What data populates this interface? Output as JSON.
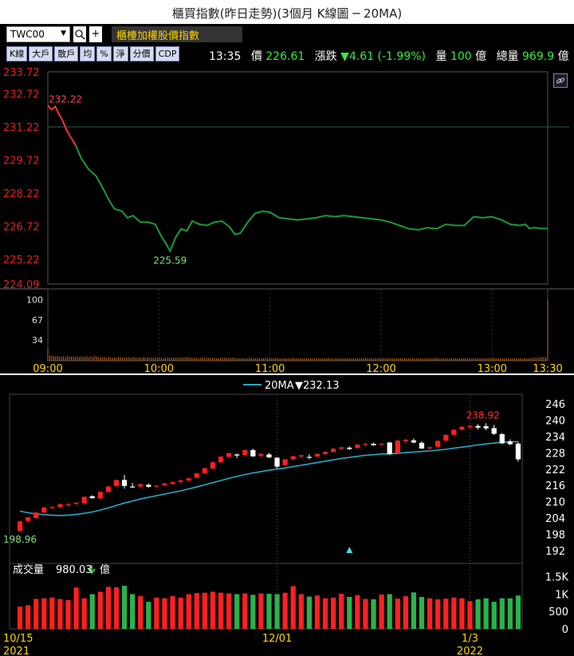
{
  "title": "櫃買指數(昨日走勢)(3個月 K線圖 ─ 20MA)",
  "toolbar": {
    "symbol": "TWC00",
    "dropdown_glyph": "▼",
    "search_glyph": "🔍",
    "add_glyph": "+",
    "name": "櫃檯加權股價指數",
    "tabs": [
      "K線",
      "大戶",
      "散戶",
      "均",
      "%",
      "淨",
      "分價",
      "CDP"
    ]
  },
  "quote": {
    "time": "13:35",
    "price_label": "價",
    "price": "226.61",
    "change_label": "漲跌",
    "change": "▼4.61 (-1.99%)",
    "volume_label": "量",
    "volume": "100",
    "volume_unit": "億",
    "total_label": "總量",
    "total": "969.9",
    "total_unit": "億"
  },
  "icons": {
    "link": "link-icon",
    "search": "search-icon",
    "volume_arrow": "down-arrow-icon",
    "marker": "triangle-up-icon"
  },
  "colors": {
    "up": "#ff2020",
    "down": "#2bb24c",
    "ma": "#2aa8c8",
    "intraday": "#1a9a3a",
    "vol": "#cc6a1a",
    "open_line": "#2f5f4f"
  },
  "intraday": {
    "price_ticks": [
      "233.72",
      "232.72",
      "231.22",
      "229.72",
      "228.22",
      "226.72",
      "225.22",
      "224.09"
    ],
    "price_tick_values": [
      233.72,
      232.72,
      231.22,
      229.72,
      228.22,
      226.72,
      225.22,
      224.09
    ],
    "time_ticks": [
      "09:00",
      "10:00",
      "11:00",
      "12:00",
      "13:00",
      "13:30"
    ],
    "time_tick_minutes": [
      0,
      60,
      120,
      180,
      240,
      270
    ],
    "volume_ticks": [
      "100",
      "67",
      "34"
    ],
    "volume_tick_values": [
      100,
      67,
      34
    ],
    "prev_close": 231.22,
    "high_label": "232.22",
    "low_label": "225.59",
    "high": 232.22,
    "low": 225.59,
    "points": [
      [
        0,
        232.2
      ],
      [
        2,
        232.0
      ],
      [
        4,
        232.15
      ],
      [
        6,
        231.8
      ],
      [
        8,
        231.5
      ],
      [
        10,
        231.1
      ],
      [
        12,
        230.8
      ],
      [
        15,
        230.4
      ],
      [
        18,
        229.8
      ],
      [
        22,
        229.3
      ],
      [
        26,
        229.0
      ],
      [
        30,
        228.4
      ],
      [
        33,
        227.9
      ],
      [
        36,
        227.5
      ],
      [
        40,
        227.4
      ],
      [
        43,
        227.1
      ],
      [
        46,
        227.2
      ],
      [
        50,
        226.9
      ],
      [
        54,
        226.9
      ],
      [
        58,
        226.8
      ],
      [
        61,
        226.3
      ],
      [
        64,
        225.9
      ],
      [
        66,
        225.59
      ],
      [
        69,
        226.2
      ],
      [
        72,
        226.6
      ],
      [
        75,
        226.5
      ],
      [
        78,
        226.95
      ],
      [
        82,
        226.8
      ],
      [
        86,
        226.75
      ],
      [
        90,
        226.9
      ],
      [
        94,
        226.95
      ],
      [
        98,
        226.7
      ],
      [
        101,
        226.35
      ],
      [
        104,
        226.4
      ],
      [
        108,
        226.9
      ],
      [
        112,
        227.3
      ],
      [
        116,
        227.4
      ],
      [
        120,
        227.35
      ],
      [
        125,
        227.1
      ],
      [
        130,
        227.05
      ],
      [
        135,
        227.0
      ],
      [
        140,
        227.05
      ],
      [
        145,
        227.1
      ],
      [
        150,
        227.2
      ],
      [
        155,
        227.15
      ],
      [
        160,
        227.2
      ],
      [
        165,
        227.15
      ],
      [
        170,
        227.1
      ],
      [
        175,
        227.05
      ],
      [
        180,
        227.0
      ],
      [
        185,
        226.9
      ],
      [
        190,
        226.75
      ],
      [
        195,
        226.6
      ],
      [
        200,
        226.55
      ],
      [
        205,
        226.65
      ],
      [
        210,
        226.6
      ],
      [
        215,
        226.8
      ],
      [
        220,
        226.75
      ],
      [
        225,
        226.75
      ],
      [
        230,
        227.15
      ],
      [
        235,
        227.1
      ],
      [
        240,
        227.15
      ],
      [
        245,
        227.0
      ],
      [
        250,
        226.8
      ],
      [
        255,
        226.75
      ],
      [
        258,
        226.8
      ],
      [
        260,
        226.62
      ],
      [
        263,
        226.65
      ],
      [
        267,
        226.61
      ],
      [
        270,
        226.61
      ]
    ],
    "volumes": [
      20,
      9,
      8,
      8,
      7,
      8,
      7,
      7,
      7,
      6,
      8,
      7,
      7,
      7,
      6,
      7,
      6,
      7,
      6,
      7,
      7,
      6,
      7,
      6,
      8,
      7,
      6,
      6,
      6,
      6,
      5,
      6,
      6,
      5,
      5,
      5,
      6,
      6,
      5,
      5,
      5,
      6,
      5,
      5,
      6,
      5,
      5,
      5,
      5,
      6,
      5,
      6,
      5,
      5,
      5,
      5,
      5,
      5,
      5,
      4,
      5,
      5,
      5,
      5,
      5,
      5,
      5,
      5,
      5,
      5,
      6,
      6,
      6,
      5,
      5,
      5,
      5,
      4,
      5,
      5,
      5,
      5,
      5,
      4,
      5,
      5,
      4,
      4,
      5,
      5,
      5,
      5,
      5,
      4,
      5,
      5,
      4,
      4,
      4,
      4,
      4,
      4,
      4,
      5,
      4,
      4,
      4,
      5,
      4,
      4,
      4,
      5,
      4,
      4,
      4,
      4,
      5,
      4,
      4,
      4,
      4,
      4,
      4,
      4,
      4,
      5,
      4,
      4,
      4,
      4,
      4,
      4,
      4,
      4,
      4,
      4,
      4,
      4,
      4,
      4,
      4,
      4,
      4,
      5,
      4,
      4,
      4,
      4,
      4,
      4,
      4,
      4,
      4,
      4,
      4,
      4,
      4,
      4,
      4,
      4,
      4,
      4,
      5,
      4,
      4,
      4,
      4,
      4,
      4,
      4,
      4,
      4,
      4,
      4,
      4,
      4,
      4,
      4,
      4,
      4,
      4,
      4,
      4,
      4,
      4,
      4,
      4,
      4,
      4,
      4,
      4,
      4,
      4,
      4,
      4,
      4,
      4,
      4,
      5,
      4,
      4,
      4,
      4,
      4,
      4,
      4,
      4,
      4,
      4,
      4,
      4,
      4,
      4,
      4,
      4,
      4,
      4,
      4,
      4,
      4,
      4,
      4,
      4,
      4,
      4,
      4,
      4,
      5,
      4,
      4,
      4,
      4,
      4,
      4,
      4,
      4,
      4,
      4,
      4,
      4,
      4,
      4,
      4,
      4,
      4,
      4,
      4,
      5,
      5,
      5,
      5,
      6,
      6,
      6,
      6,
      100
    ]
  },
  "kline": {
    "ma_label": "20MA",
    "ma_change": "▼232.13",
    "price_ticks": [
      "246",
      "240",
      "234",
      "228",
      "222",
      "216",
      "210",
      "204",
      "198",
      "192"
    ],
    "price_tick_values": [
      246,
      240,
      234,
      228,
      222,
      216,
      210,
      204,
      198,
      192
    ],
    "vol_ticks": [
      "1.5K",
      "1K",
      "500",
      "0"
    ],
    "vol_tick_values": [
      1500,
      1000,
      500,
      0
    ],
    "volume_label": "成交量",
    "volume_value": "980.03",
    "volume_unit": "億",
    "max_label": "238.92",
    "min_label": "198.96",
    "date_ticks": [
      {
        "label": "10/15",
        "year": "2021",
        "index": 0
      },
      {
        "label": "12/01",
        "year": "",
        "index": 32
      },
      {
        "label": "1/3",
        "year": "2022",
        "index": 56
      }
    ],
    "marker_index": 41,
    "candles": [
      [
        199.2,
        203.1,
        198.96,
        202.7,
        640
      ],
      [
        202.9,
        204.6,
        202.3,
        204.2,
        680
      ],
      [
        204.0,
        206.3,
        203.6,
        206.0,
        860
      ],
      [
        206.0,
        208.2,
        205.8,
        207.8,
        880
      ],
      [
        207.9,
        208.4,
        207.2,
        208.0,
        900
      ],
      [
        208.0,
        209.4,
        207.7,
        209.0,
        860
      ],
      [
        208.8,
        209.5,
        208.2,
        209.0,
        830
      ],
      [
        209.2,
        209.8,
        208.8,
        209.6,
        1190
      ],
      [
        209.4,
        212.0,
        209.1,
        211.8,
        880
      ],
      [
        212.0,
        212.4,
        211.0,
        211.3,
        1000
      ],
      [
        211.2,
        213.8,
        210.9,
        213.6,
        1070
      ],
      [
        213.6,
        215.8,
        213.5,
        215.6,
        1210
      ],
      [
        215.8,
        218.1,
        215.5,
        218.0,
        1200
      ],
      [
        218.0,
        219.9,
        214.8,
        215.8,
        1240
      ],
      [
        215.6,
        216.9,
        215.0,
        215.4,
        1000
      ],
      [
        215.6,
        216.6,
        215.0,
        216.4,
        940
      ],
      [
        216.2,
        216.7,
        215.1,
        215.5,
        780
      ],
      [
        215.8,
        216.1,
        215.2,
        215.9,
        900
      ],
      [
        216.0,
        216.9,
        215.7,
        216.7,
        880
      ],
      [
        216.6,
        217.3,
        216.2,
        217.2,
        940
      ],
      [
        217.3,
        218.2,
        216.8,
        217.8,
        900
      ],
      [
        217.8,
        218.9,
        217.4,
        218.6,
        1000
      ],
      [
        218.8,
        220.6,
        218.6,
        220.4,
        1030
      ],
      [
        220.4,
        222.6,
        220.3,
        222.3,
        1040
      ],
      [
        222.2,
        224.8,
        222.0,
        224.5,
        1070
      ],
      [
        224.5,
        226.8,
        224.3,
        226.6,
        1040
      ],
      [
        226.5,
        228.1,
        226.3,
        227.9,
        1020
      ],
      [
        227.4,
        227.7,
        226.0,
        227.0,
        1000
      ],
      [
        227.2,
        229.2,
        226.7,
        229.0,
        1020
      ],
      [
        229.0,
        229.5,
        226.5,
        226.7,
        980
      ],
      [
        226.9,
        227.8,
        226.2,
        227.6,
        1020
      ],
      [
        227.4,
        227.9,
        226.1,
        226.3,
        1010
      ],
      [
        226.2,
        226.4,
        222.3,
        222.9,
        1000
      ],
      [
        223.5,
        225.8,
        223.1,
        225.6,
        1040
      ],
      [
        225.6,
        226.9,
        225.3,
        226.7,
        1230
      ],
      [
        226.6,
        227.2,
        226.0,
        227.1,
        1000
      ],
      [
        226.5,
        227.5,
        225.6,
        226.3,
        930
      ],
      [
        226.6,
        227.8,
        226.5,
        227.6,
        960
      ],
      [
        227.5,
        228.6,
        227.3,
        228.3,
        880
      ],
      [
        228.3,
        229.9,
        228.2,
        229.5,
        900
      ],
      [
        229.5,
        230.3,
        229.0,
        230.0,
        1010
      ],
      [
        229.9,
        230.4,
        229.0,
        229.4,
        920
      ],
      [
        229.8,
        231.3,
        229.5,
        231.0,
        970
      ],
      [
        231.0,
        231.6,
        230.4,
        231.3,
        860
      ],
      [
        231.3,
        231.8,
        230.6,
        230.8,
        850
      ],
      [
        231.2,
        231.5,
        230.4,
        231.4,
        990
      ],
      [
        231.8,
        232.0,
        227.2,
        227.6,
        1000
      ],
      [
        227.9,
        232.8,
        227.6,
        232.5,
        870
      ],
      [
        232.3,
        233.3,
        231.4,
        232.8,
        940
      ],
      [
        232.6,
        233.3,
        231.5,
        231.8,
        1050
      ],
      [
        231.7,
        232.3,
        229.4,
        229.6,
        920
      ],
      [
        229.6,
        230.4,
        229.2,
        230.0,
        880
      ],
      [
        230.2,
        232.6,
        230.0,
        232.4,
        850
      ],
      [
        232.5,
        234.9,
        232.3,
        234.6,
        870
      ],
      [
        234.6,
        236.8,
        234.4,
        236.5,
        900
      ],
      [
        236.5,
        237.8,
        236.3,
        237.6,
        880
      ],
      [
        237.4,
        238.4,
        236.9,
        237.9,
        800
      ],
      [
        237.9,
        238.6,
        236.6,
        237.3,
        850
      ],
      [
        237.8,
        238.92,
        236.3,
        237.0,
        880
      ],
      [
        237.1,
        238.3,
        234.6,
        235.0,
        780
      ],
      [
        234.9,
        235.3,
        231.2,
        231.5,
        880
      ],
      [
        232.2,
        233.0,
        230.8,
        231.2,
        880
      ],
      [
        231.4,
        232.0,
        224.8,
        225.6,
        960
      ]
    ],
    "ma": [
      206.5,
      205.9,
      205.5,
      205.2,
      205.0,
      204.9,
      205.0,
      205.3,
      205.7,
      206.2,
      206.9,
      207.7,
      208.6,
      209.5,
      210.2,
      211.0,
      211.6,
      212.2,
      212.8,
      213.4,
      214.0,
      214.7,
      215.4,
      216.2,
      217.0,
      217.8,
      218.6,
      219.3,
      220.0,
      220.6,
      221.1,
      221.6,
      222.0,
      222.4,
      222.9,
      223.4,
      223.9,
      224.4,
      224.9,
      225.4,
      225.9,
      226.3,
      226.7,
      227.1,
      227.3,
      227.6,
      227.6,
      227.8,
      228.1,
      228.3,
      228.5,
      228.7,
      229.0,
      229.3,
      229.7,
      230.1,
      230.5,
      230.9,
      231.3,
      231.6,
      231.9,
      232.1,
      232.13
    ]
  }
}
